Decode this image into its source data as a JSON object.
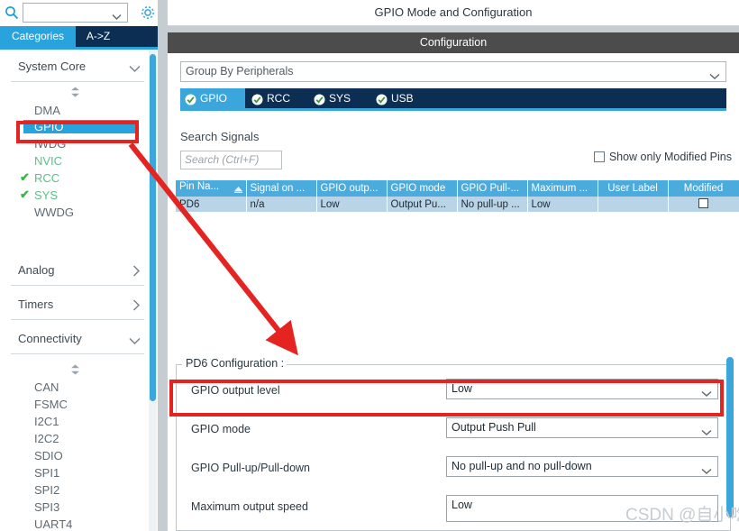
{
  "sidebar": {
    "search": {
      "value": "",
      "placeholder": "",
      "icon": "search-icon"
    },
    "gear_icon": "gear-icon",
    "tabs": [
      {
        "label": "Categories",
        "active": true
      },
      {
        "label": "A->Z",
        "active": false
      }
    ],
    "groups": [
      {
        "label": "System Core",
        "expanded": true,
        "items": [
          {
            "label": "DMA",
            "state": "normal"
          },
          {
            "label": "GPIO",
            "state": "selected"
          },
          {
            "label": "IWDG",
            "state": "normal"
          },
          {
            "label": "NVIC",
            "state": "green"
          },
          {
            "label": "RCC",
            "state": "green-check"
          },
          {
            "label": "SYS",
            "state": "green-check"
          },
          {
            "label": "WWDG",
            "state": "normal"
          }
        ]
      },
      {
        "label": "Analog",
        "expanded": false,
        "items": []
      },
      {
        "label": "Timers",
        "expanded": false,
        "items": []
      },
      {
        "label": "Connectivity",
        "expanded": true,
        "items": [
          {
            "label": "CAN",
            "state": "normal"
          },
          {
            "label": "FSMC",
            "state": "normal"
          },
          {
            "label": "I2C1",
            "state": "normal"
          },
          {
            "label": "I2C2",
            "state": "normal"
          },
          {
            "label": "SDIO",
            "state": "normal"
          },
          {
            "label": "SPI1",
            "state": "normal"
          },
          {
            "label": "SPI2",
            "state": "normal"
          },
          {
            "label": "SPI3",
            "state": "normal"
          },
          {
            "label": "UART4",
            "state": "normal"
          }
        ]
      }
    ]
  },
  "header": {
    "title": "GPIO Mode and Configuration",
    "configuration_bar": "Configuration"
  },
  "main": {
    "group_by": {
      "value": "Group By Peripherals"
    },
    "peripheral_tabs": [
      {
        "label": "GPIO",
        "active": true,
        "icon": "check-circle-icon"
      },
      {
        "label": "RCC",
        "active": false,
        "icon": "check-circle-icon"
      },
      {
        "label": "SYS",
        "active": false,
        "icon": "check-circle-icon"
      },
      {
        "label": "USB",
        "active": false,
        "icon": "check-circle-icon"
      }
    ],
    "search_signals": {
      "label": "Search Signals",
      "placeholder": "Search (Ctrl+F)",
      "value": ""
    },
    "show_only_modified": {
      "label": "Show only Modified Pins",
      "checked": false
    },
    "pin_table": {
      "columns": [
        "Pin Na...",
        "Signal on ...",
        "GPIO outp...",
        "GPIO mode",
        "GPIO Pull-...",
        "Maximum ...",
        "User Label",
        "Modified"
      ],
      "rows": [
        {
          "pin_name": "PD6",
          "signal_on": "n/a",
          "gpio_output": "Low",
          "gpio_mode": "Output Pu...",
          "gpio_pull": "No pull-up ...",
          "maximum": "Low",
          "user_label": "",
          "modified": false
        }
      ]
    },
    "pin_config": {
      "legend": "PD6 Configuration :",
      "rows": [
        {
          "label": "GPIO output level",
          "value": "Low"
        },
        {
          "label": "GPIO mode",
          "value": "Output Push Pull"
        },
        {
          "label": "GPIO Pull-up/Pull-down",
          "value": "No pull-up and no pull-down"
        },
        {
          "label": "Maximum output speed",
          "value": "Low"
        }
      ]
    }
  },
  "annotations": {
    "color": "#e52421",
    "gpio_box": "gpio-tree-item-highlight",
    "output_level_box": "gpio-output-level-highlight",
    "arrow": "red-arrow"
  },
  "watermark": {
    "text": "CSDN @自小吃多"
  }
}
